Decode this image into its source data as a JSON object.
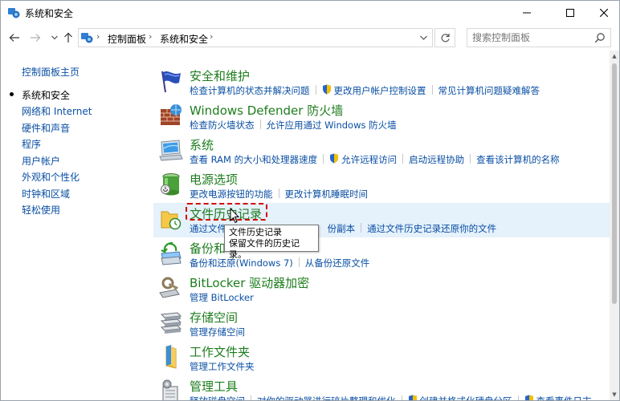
{
  "window": {
    "title": "系统和安全"
  },
  "breadcrumb": {
    "items": [
      "控制面板",
      "系统和安全"
    ]
  },
  "search": {
    "placeholder": "搜索控制面板"
  },
  "leftnav": {
    "home": "控制面板主页",
    "items": [
      "系统和安全",
      "网络和 Internet",
      "硬件和声音",
      "程序",
      "用户帐户",
      "外观和个性化",
      "时钟和区域",
      "轻松使用"
    ]
  },
  "categories": [
    {
      "title": "安全和维护",
      "links": [
        "检查计算机的状态并解决问题",
        "更改用户帐户控制设置",
        "常见计算机问题疑难解答"
      ]
    },
    {
      "title": "Windows Defender 防火墙",
      "links": [
        "检查防火墙状态",
        "允许应用通过 Windows 防火墙"
      ]
    },
    {
      "title": "系统",
      "links": [
        "查看 RAM 的大小和处理器速度",
        "允许远程访问",
        "启动远程协助",
        "查看该计算机的名称"
      ]
    },
    {
      "title": "电源选项",
      "links": [
        "更改电源按钮的功能",
        "更改计算机睡眠时间"
      ]
    },
    {
      "title": "文件历史记录",
      "links": [
        "通过文件",
        "份副本",
        "通过文件历史记录还原你的文件"
      ]
    },
    {
      "title": "备份和",
      "links": [
        "备份和还原(Windows 7)",
        "从备份还原文件"
      ]
    },
    {
      "title": "BitLocker 驱动器加密",
      "links": [
        "管理 BitLocker"
      ]
    },
    {
      "title": "存储空间",
      "links": [
        "管理存储空间"
      ]
    },
    {
      "title": "工作文件夹",
      "links": [
        "管理工作文件夹"
      ]
    },
    {
      "title": "管理工具",
      "links": [
        "释放磁盘空间",
        "对你的驱动器进行碎片整理和优化",
        "创建并格式化硬盘分区",
        "查看事件日志"
      ]
    }
  ],
  "tooltip": {
    "line1": "文件历史记录",
    "line2": "保留文件的历史记录。"
  },
  "colors": {
    "link": "#0a4fa3",
    "category_title": "#1e7d1e",
    "hover_bg": "#e5f1fb",
    "highlight": "#d40000"
  }
}
